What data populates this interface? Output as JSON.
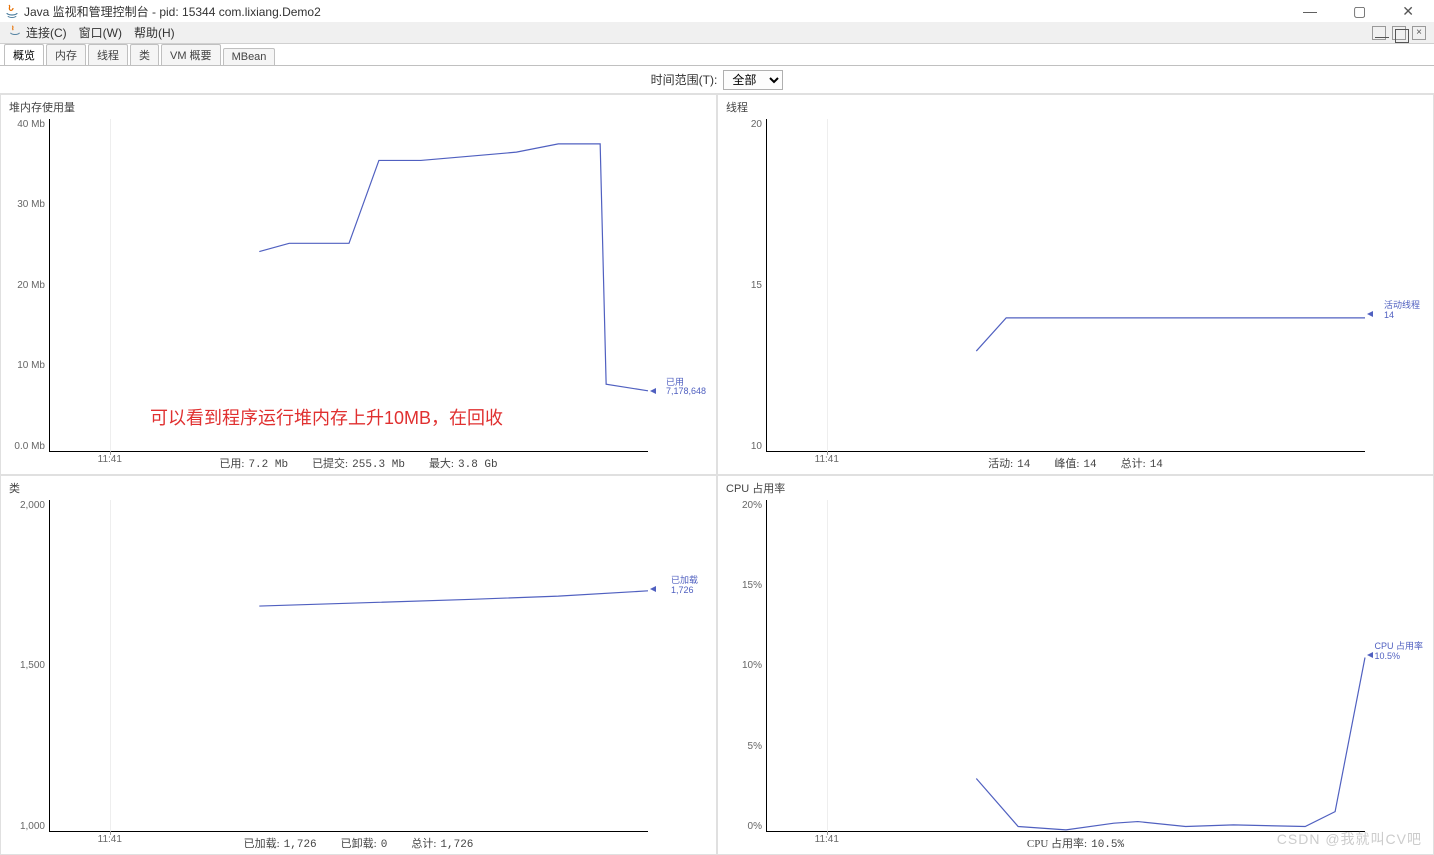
{
  "titlebar": {
    "title": "Java 监视和管理控制台 - pid: 15344 com.lixiang.Demo2"
  },
  "menubar": {
    "connect": "连接(C)",
    "window": "窗口(W)",
    "help": "帮助(H)"
  },
  "tabs": {
    "overview": "概览",
    "memory": "内存",
    "threads": "线程",
    "classes": "类",
    "vm": "VM 概要",
    "mbean": "MBean"
  },
  "timerange": {
    "label": "时间范围(T):",
    "value": "全部"
  },
  "panels": {
    "heap": {
      "title": "堆内存使用量",
      "footer": {
        "used_label": "已用:",
        "used_value": "7.2  Mb",
        "committed_label": "已提交:",
        "committed_value": "255.3  Mb",
        "max_label": "最大:",
        "max_value": "3.8  Gb"
      },
      "marker": {
        "label1": "已用",
        "label2": "7,178,648"
      },
      "annotation": "可以看到程序运行堆内存上升10MB，在回收",
      "x_tick": "11:41"
    },
    "threads": {
      "title": "线程",
      "footer": {
        "active_label": "活动:",
        "active_value": "14",
        "peak_label": "峰值:",
        "peak_value": "14",
        "total_label": "总计:",
        "total_value": "14"
      },
      "marker": {
        "label1": "活动线程",
        "label2": "14"
      },
      "x_tick": "11:41"
    },
    "classes": {
      "title": "类",
      "footer": {
        "loaded_label": "已加载:",
        "loaded_value": "1,726",
        "unloaded_label": "已卸载:",
        "unloaded_value": "0",
        "total_label": "总计:",
        "total_value": "1,726"
      },
      "marker": {
        "label1": "已加载",
        "label2": "1,726"
      },
      "x_tick": "11:41"
    },
    "cpu": {
      "title": "CPU 占用率",
      "footer": {
        "usage_label": "CPU 占用率:",
        "usage_value": "10.5%"
      },
      "marker": {
        "label1": "CPU 占用率",
        "label2": "10.5%"
      },
      "x_tick": "11:41"
    }
  },
  "chart_data": [
    {
      "type": "line",
      "title": "堆内存使用量",
      "xlabel": "",
      "ylabel": "Mb",
      "ylim": [
        0,
        40
      ],
      "y_ticks": [
        "0.0 Mb",
        "10 Mb",
        "20 Mb",
        "30 Mb",
        "40 Mb"
      ],
      "x": [
        0.35,
        0.4,
        0.45,
        0.5,
        0.55,
        0.62,
        0.7,
        0.78,
        0.85,
        0.92,
        0.93,
        1.0
      ],
      "values": [
        24,
        25,
        25,
        25,
        35,
        35,
        35.5,
        36,
        37,
        37,
        8,
        7.2
      ]
    },
    {
      "type": "line",
      "title": "线程",
      "xlabel": "",
      "ylabel": "",
      "ylim": [
        10,
        20
      ],
      "y_ticks": [
        "10",
        "15",
        "20"
      ],
      "x": [
        0.35,
        0.4,
        1.0
      ],
      "values": [
        13,
        14,
        14
      ]
    },
    {
      "type": "line",
      "title": "类",
      "xlabel": "",
      "ylabel": "",
      "ylim": [
        1000,
        2000
      ],
      "y_ticks": [
        "1,000",
        "1,500",
        "2,000"
      ],
      "x": [
        0.35,
        0.7,
        0.85,
        1.0
      ],
      "values": [
        1680,
        1700,
        1710,
        1726
      ]
    },
    {
      "type": "line",
      "title": "CPU 占用率",
      "xlabel": "",
      "ylabel": "%",
      "ylim": [
        0,
        20
      ],
      "y_ticks": [
        "0%",
        "5%",
        "10%",
        "15%",
        "20%"
      ],
      "x": [
        0.35,
        0.42,
        0.5,
        0.58,
        0.62,
        0.7,
        0.78,
        0.9,
        0.95,
        1.0
      ],
      "values": [
        3.2,
        0.3,
        0.1,
        0.5,
        0.6,
        0.3,
        0.4,
        0.3,
        1.2,
        10.5
      ]
    }
  ],
  "watermark": "CSDN @我就叫CV吧"
}
